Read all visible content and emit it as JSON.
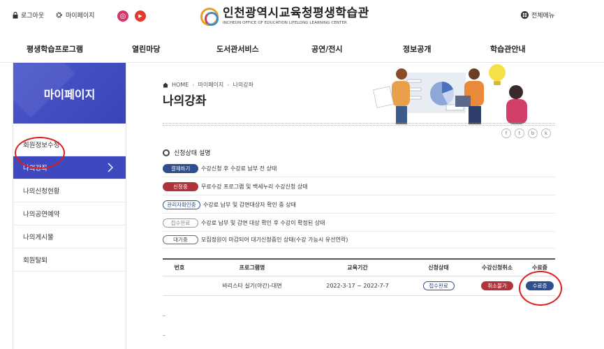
{
  "util": {
    "logout": "로그아웃",
    "mypage": "마이페이지",
    "all_menu": "전체메뉴",
    "sns": [
      {
        "icon": "facebook-icon",
        "glyph": "f",
        "color": "#3b5998"
      },
      {
        "icon": "instagram-icon",
        "glyph": "◎",
        "color": "#d6336c"
      },
      {
        "icon": "youtube-icon",
        "glyph": "▶",
        "color": "#e03a2f"
      }
    ]
  },
  "logo": {
    "title": "인천광역시교육청평생학습관",
    "subtitle": "INCHEON OFFICE OF EDUCATION LIFELONG LEARNING CENTER"
  },
  "gnb": [
    "평생학습프로그램",
    "열린마당",
    "도서관서비스",
    "공연/전시",
    "정보공개",
    "학습관안내"
  ],
  "sidebar": {
    "title": "마이페이지",
    "items": [
      {
        "label": "회원정보수정",
        "active": false
      },
      {
        "label": "나의강좌",
        "active": true
      },
      {
        "label": "나의신청현황",
        "active": false
      },
      {
        "label": "나의공연예약",
        "active": false
      },
      {
        "label": "나의게시물",
        "active": false
      },
      {
        "label": "회원탈퇴",
        "active": false
      }
    ]
  },
  "breadcrumb": [
    "HOME",
    "마이페이지",
    "나의강좌"
  ],
  "page_title": "나의강좌",
  "share_icons": [
    "f",
    "t",
    "b",
    "k"
  ],
  "legend": {
    "heading": "신청상태 설명",
    "rows": [
      {
        "badge": "결제하기",
        "style": "b-blue",
        "desc": "수강신청 후 수강료 납부 전 상태"
      },
      {
        "badge": "신청중",
        "style": "b-red",
        "desc": "무료수강 프로그램 및 백세누리 수강신청 상태"
      },
      {
        "badge": "관리자확인중",
        "style": "b-outline-blue",
        "desc": "수강료 납부 및 감면대상자 확인 중 상태"
      },
      {
        "badge": "접수완료",
        "style": "b-outline-gray",
        "desc": "수강료 납부 및 감면 대상 확인 후 수강이 확정된 상태"
      },
      {
        "badge": "대기중",
        "style": "b-outline-dark",
        "desc": "모집정원이 마감되어 대기신청중인 상태(수강 가능시 유선연락)"
      }
    ]
  },
  "table": {
    "headers": [
      "번호",
      "프로그램명",
      "교육기간",
      "신청상태",
      "수강신청취소",
      "수료증"
    ],
    "rows": [
      {
        "no": "",
        "program": "바리스타 실기(야간)-대면",
        "period": "2022-3-17 ~ 2022-7-7",
        "status": "접수완료",
        "cancel": "취소불가",
        "certificate": "수료증"
      }
    ]
  }
}
